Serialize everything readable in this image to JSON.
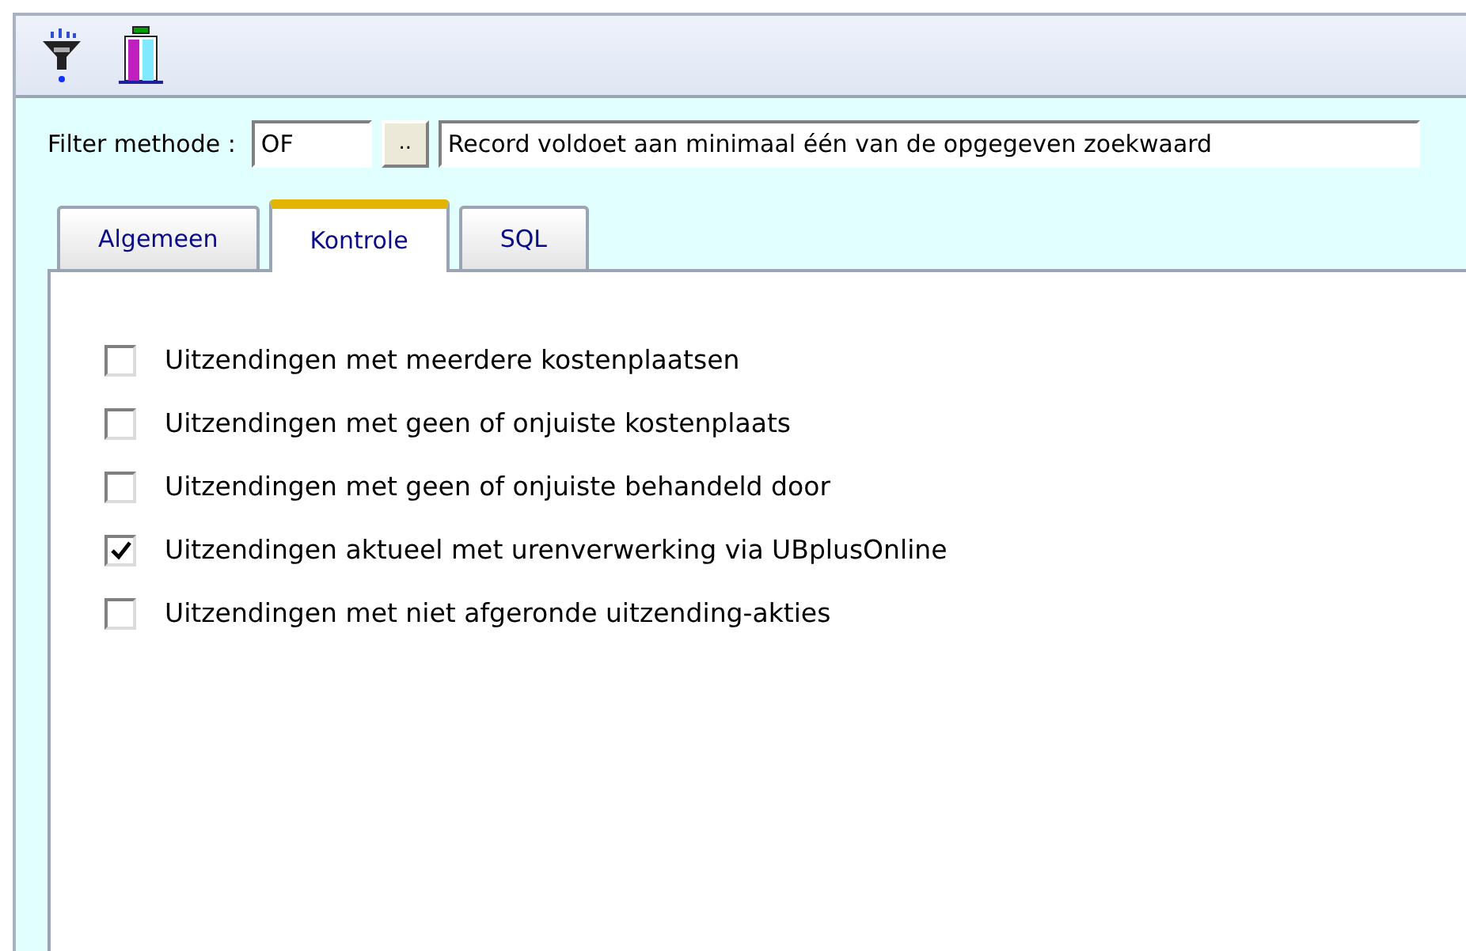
{
  "toolbar": {
    "buttons": [
      {
        "kind": "filter"
      },
      {
        "kind": "columns"
      }
    ]
  },
  "filter": {
    "label": "Filter methode :",
    "value": "OF",
    "browse_button": "..",
    "description": "Record voldoet aan minimaal één van de opgegeven zoekwaard"
  },
  "tabs": [
    {
      "label": "Algemeen",
      "selected": false
    },
    {
      "label": "Kontrole",
      "selected": true
    },
    {
      "label": "SQL",
      "selected": false
    }
  ],
  "checks": [
    {
      "label": "Uitzendingen met meerdere kostenplaatsen",
      "checked": false
    },
    {
      "label": "Uitzendingen met geen of onjuiste kostenplaats",
      "checked": false
    },
    {
      "label": "Uitzendingen met geen of onjuiste behandeld door",
      "checked": false
    },
    {
      "label": "Uitzendingen aktueel met urenverwerking via UBplusOnline",
      "checked": true
    },
    {
      "label": "Uitzendingen met niet afgeronde uitzending-akties",
      "checked": false
    }
  ]
}
